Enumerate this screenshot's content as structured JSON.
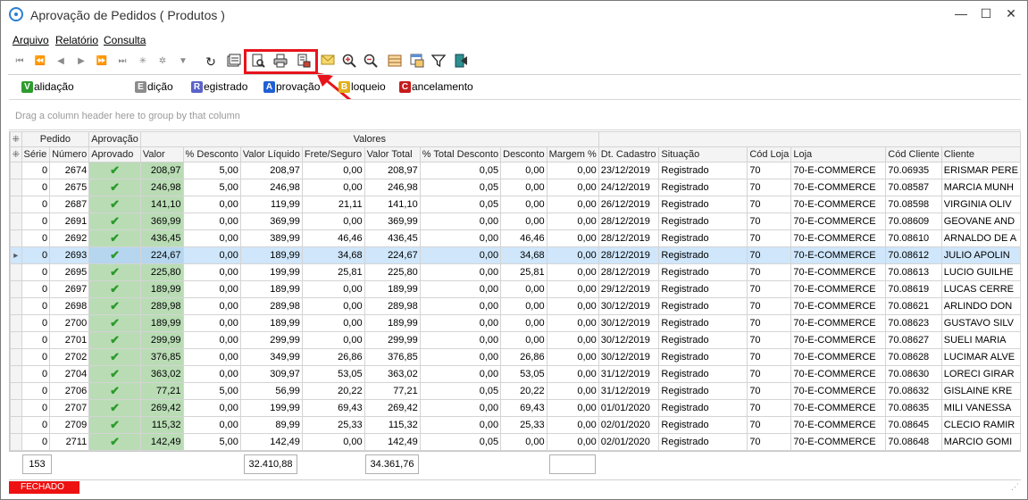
{
  "window": {
    "title": "Aprovação de Pedidos ( Produtos )"
  },
  "menu": [
    {
      "label": "Arquivo",
      "ul": "A"
    },
    {
      "label": "Relatório",
      "ul": "R"
    },
    {
      "label": "Consulta",
      "ul": "C"
    }
  ],
  "toolbar": {
    "nav": [
      "first-icon",
      "prev-page-icon",
      "prev-icon",
      "next-icon",
      "next-page-icon",
      "last-icon",
      "insert-icon",
      "delete-icon",
      "filter-row-icon"
    ],
    "actions": [
      "refresh-icon",
      "properties-icon",
      "preview-icon",
      "print-icon",
      "export-icon",
      "mail-icon",
      "zoom-in-icon",
      "zoom-out-icon",
      "grid-config-icon",
      "window-icon",
      "filter-icon",
      "exit-icon"
    ]
  },
  "legend": [
    {
      "letter": "V",
      "rest": "alidação",
      "color": "#2e9b2e"
    },
    {
      "letter": "E",
      "rest": "dição",
      "color": "#8c8c8c"
    },
    {
      "letter": "R",
      "rest": "egistrado",
      "color": "#5b63c9"
    },
    {
      "letter": "A",
      "rest": "provação",
      "color": "#1f5fd6"
    },
    {
      "letter": "B",
      "rest": "loqueio",
      "color": "#e2b018"
    },
    {
      "letter": "C",
      "rest": "ancelamento",
      "color": "#c61c1c"
    }
  ],
  "group_hint": "Drag a column header here to group by that column",
  "bands": {
    "pedido": "Pedido",
    "aprovacao": "Aprovação",
    "valores": "Valores"
  },
  "columns": [
    "Série",
    "Número",
    "Aprovado",
    "Valor",
    "% Desconto",
    "Valor Líquido",
    "Frete/Seguro",
    "Valor Total",
    "% Total Desconto",
    "Desconto",
    "Margem %",
    "Dt. Cadastro",
    "Situação",
    "Cód Loja",
    "Loja",
    "Cód Cliente",
    "Cliente"
  ],
  "rows": [
    [
      "0",
      "2674",
      "208,97",
      "5,00",
      "208,97",
      "0,00",
      "208,97",
      "0,05",
      "0,00",
      "0,00",
      "23/12/2019",
      "Registrado",
      "70",
      "70-E-COMMERCE",
      "70.06935",
      "ERISMAR PERE"
    ],
    [
      "0",
      "2675",
      "246,98",
      "5,00",
      "246,98",
      "0,00",
      "246,98",
      "0,05",
      "0,00",
      "0,00",
      "24/12/2019",
      "Registrado",
      "70",
      "70-E-COMMERCE",
      "70.08587",
      "MARCIA MUNH"
    ],
    [
      "0",
      "2687",
      "141,10",
      "0,00",
      "119,99",
      "21,11",
      "141,10",
      "0,05",
      "0,00",
      "0,00",
      "26/12/2019",
      "Registrado",
      "70",
      "70-E-COMMERCE",
      "70.08598",
      "VIRGINIA OLIV"
    ],
    [
      "0",
      "2691",
      "369,99",
      "0,00",
      "369,99",
      "0,00",
      "369,99",
      "0,00",
      "0,00",
      "0,00",
      "28/12/2019",
      "Registrado",
      "70",
      "70-E-COMMERCE",
      "70.08609",
      "GEOVANE AND"
    ],
    [
      "0",
      "2692",
      "436,45",
      "0,00",
      "389,99",
      "46,46",
      "436,45",
      "0,00",
      "46,46",
      "0,00",
      "28/12/2019",
      "Registrado",
      "70",
      "70-E-COMMERCE",
      "70.08610",
      "ARNALDO DE A"
    ],
    [
      "0",
      "2693",
      "224,67",
      "0,00",
      "189,99",
      "34,68",
      "224,67",
      "0,00",
      "34,68",
      "0,00",
      "28/12/2019",
      "Registrado",
      "70",
      "70-E-COMMERCE",
      "70.08612",
      "JULIO APOLIN"
    ],
    [
      "0",
      "2695",
      "225,80",
      "0,00",
      "199,99",
      "25,81",
      "225,80",
      "0,00",
      "25,81",
      "0,00",
      "28/12/2019",
      "Registrado",
      "70",
      "70-E-COMMERCE",
      "70.08613",
      "LUCIO GUILHE"
    ],
    [
      "0",
      "2697",
      "189,99",
      "0,00",
      "189,99",
      "0,00",
      "189,99",
      "0,00",
      "0,00",
      "0,00",
      "29/12/2019",
      "Registrado",
      "70",
      "70-E-COMMERCE",
      "70.08619",
      "LUCAS CERRE"
    ],
    [
      "0",
      "2698",
      "289,98",
      "0,00",
      "289,98",
      "0,00",
      "289,98",
      "0,00",
      "0,00",
      "0,00",
      "30/12/2019",
      "Registrado",
      "70",
      "70-E-COMMERCE",
      "70.08621",
      "ARLINDO DON"
    ],
    [
      "0",
      "2700",
      "189,99",
      "0,00",
      "189,99",
      "0,00",
      "189,99",
      "0,00",
      "0,00",
      "0,00",
      "30/12/2019",
      "Registrado",
      "70",
      "70-E-COMMERCE",
      "70.08623",
      "GUSTAVO SILV"
    ],
    [
      "0",
      "2701",
      "299,99",
      "0,00",
      "299,99",
      "0,00",
      "299,99",
      "0,00",
      "0,00",
      "0,00",
      "30/12/2019",
      "Registrado",
      "70",
      "70-E-COMMERCE",
      "70.08627",
      "SUELI MARIA"
    ],
    [
      "0",
      "2702",
      "376,85",
      "0,00",
      "349,99",
      "26,86",
      "376,85",
      "0,00",
      "26,86",
      "0,00",
      "30/12/2019",
      "Registrado",
      "70",
      "70-E-COMMERCE",
      "70.08628",
      "LUCIMAR ALVE"
    ],
    [
      "0",
      "2704",
      "363,02",
      "0,00",
      "309,97",
      "53,05",
      "363,02",
      "0,00",
      "53,05",
      "0,00",
      "31/12/2019",
      "Registrado",
      "70",
      "70-E-COMMERCE",
      "70.08630",
      "LORECI GIRAR"
    ],
    [
      "0",
      "2706",
      "77,21",
      "5,00",
      "56,99",
      "20,22",
      "77,21",
      "0,05",
      "20,22",
      "0,00",
      "31/12/2019",
      "Registrado",
      "70",
      "70-E-COMMERCE",
      "70.08632",
      "GISLAINE KRE"
    ],
    [
      "0",
      "2707",
      "269,42",
      "0,00",
      "199,99",
      "69,43",
      "269,42",
      "0,00",
      "69,43",
      "0,00",
      "01/01/2020",
      "Registrado",
      "70",
      "70-E-COMMERCE",
      "70.08635",
      "MILI VANESSA"
    ],
    [
      "0",
      "2709",
      "115,32",
      "0,00",
      "89,99",
      "25,33",
      "115,32",
      "0,00",
      "25,33",
      "0,00",
      "02/01/2020",
      "Registrado",
      "70",
      "70-E-COMMERCE",
      "70.08645",
      "CLECIO RAMIR"
    ],
    [
      "0",
      "2711",
      "142,49",
      "5,00",
      "142,49",
      "0,00",
      "142,49",
      "0,05",
      "0,00",
      "0,00",
      "02/01/2020",
      "Registrado",
      "70",
      "70-E-COMMERCE",
      "70.08648",
      "MARCIO GOMI"
    ]
  ],
  "selected_row": 5,
  "totals": {
    "count": "153",
    "valor_liquido": "32.410,88",
    "valor_total": "34.361,76",
    "margem": ""
  },
  "status": {
    "label": "FECHADO",
    "color": "#ee1111"
  }
}
